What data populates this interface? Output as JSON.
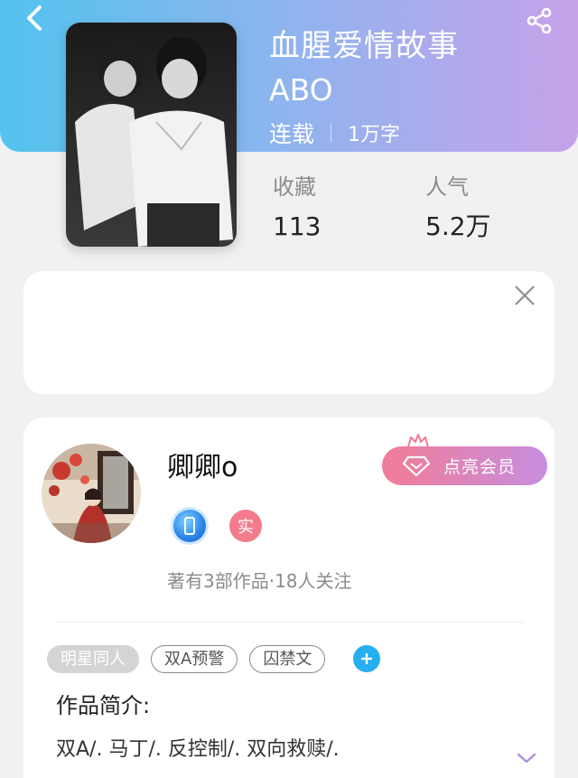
{
  "header": {
    "back_icon": "chevron-left-icon",
    "share_icon": "share-icon",
    "gradient": [
      "#53c3ee",
      "#c7a2ea"
    ]
  },
  "book": {
    "title": "血腥爱情故事",
    "subtitle": "ABO",
    "status": "连载",
    "word_count": "1万字"
  },
  "stats": [
    {
      "label": "收藏",
      "value": "113"
    },
    {
      "label": "人气",
      "value": "5.2万"
    }
  ],
  "ad": {
    "close_icon": "close-icon"
  },
  "author": {
    "name": "卿卿o",
    "vip_button": "点亮会员",
    "vip_colors": [
      "#f27c95",
      "#c78ee0"
    ],
    "badge_real": "实",
    "stats_text": "著有3部作品·18人关注"
  },
  "tags": [
    "明星同人",
    "双A预警",
    "囚禁文"
  ],
  "intro": {
    "title": "作品简介:",
    "text": "双A/.  马丁/.  反控制/.  双向救赎/."
  }
}
